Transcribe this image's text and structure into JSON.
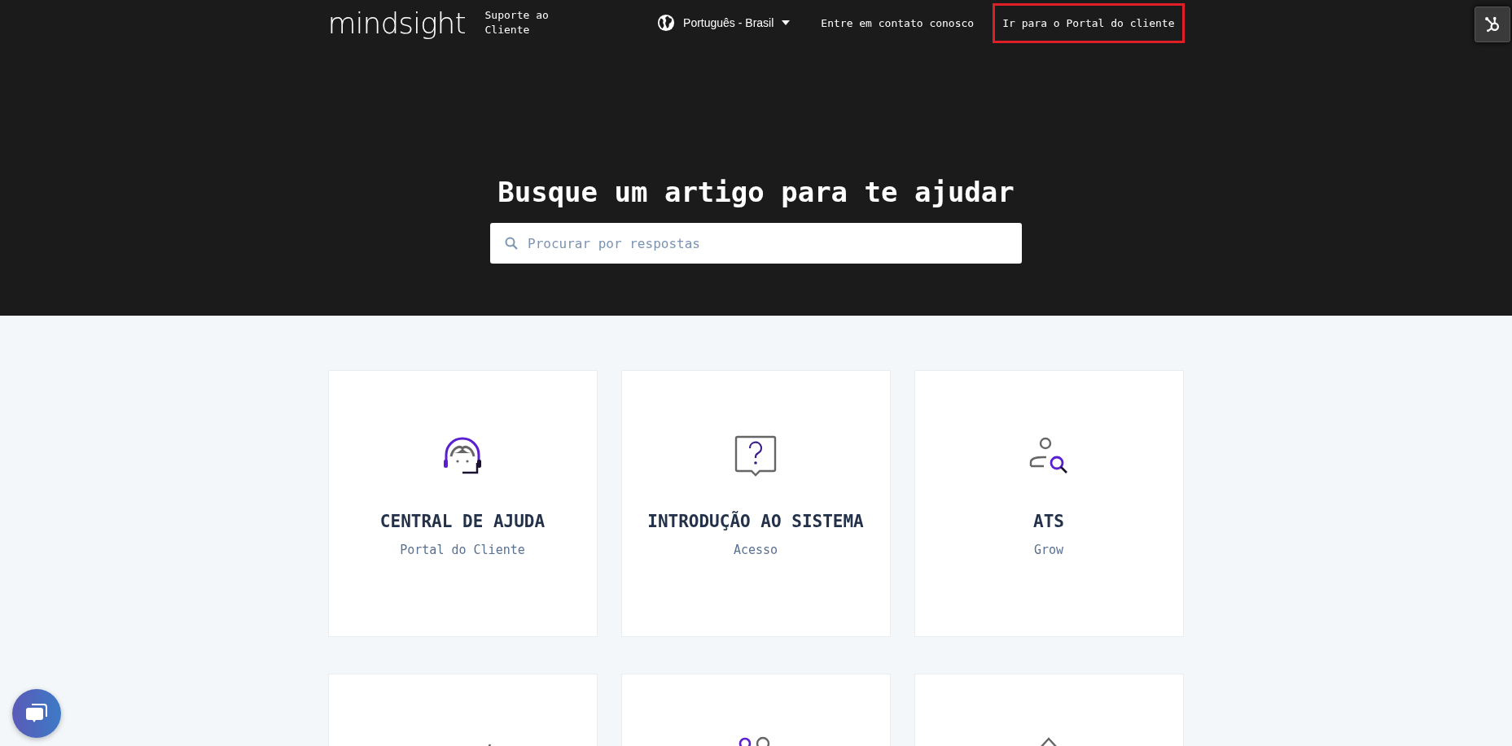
{
  "header": {
    "logo": "mindsight",
    "subtitle": "Suporte ao Cliente",
    "language": "Português - Brasil",
    "links": [
      {
        "label": "Entre em contato conosco",
        "highlighted": false
      },
      {
        "label": "Ir para o Portal do cliente",
        "highlighted": true
      }
    ]
  },
  "hero": {
    "title": "Busque um artigo para te ajudar",
    "search": {
      "placeholder": "Procurar por respostas"
    }
  },
  "cards": [
    {
      "kind": "headset",
      "title": "CENTRAL DE AJUDA",
      "subtitle": "Portal do Cliente"
    },
    {
      "kind": "question",
      "title": "INTRODUÇÃO AO SISTEMA",
      "subtitle": "Acesso"
    },
    {
      "kind": "person-search",
      "title": "ATS",
      "subtitle": "Grow"
    },
    {
      "kind": "pencil"
    },
    {
      "kind": "people"
    },
    {
      "kind": "house"
    }
  ]
}
